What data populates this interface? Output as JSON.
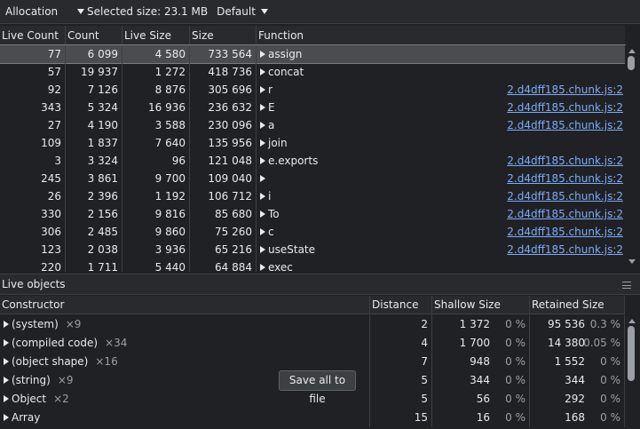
{
  "toolbar": {
    "mode_select": "Allocation",
    "selected_size": "Selected size: 23.1 MB",
    "view_select": "Default"
  },
  "allocation_table": {
    "columns": [
      "Live Count",
      "Count",
      "Live Size",
      "Size",
      "Function"
    ],
    "rows": [
      {
        "live_count": "77",
        "count": "6 099",
        "live_size": "4 580",
        "size": "733 564",
        "function": "assign",
        "source": ""
      },
      {
        "live_count": "57",
        "count": "19 937",
        "live_size": "1 272",
        "size": "418 736",
        "function": "concat",
        "source": ""
      },
      {
        "live_count": "92",
        "count": "7 126",
        "live_size": "8 876",
        "size": "305 696",
        "function": "r",
        "source": "2.d4dff185.chunk.js:2"
      },
      {
        "live_count": "343",
        "count": "5 324",
        "live_size": "16 936",
        "size": "236 632",
        "function": "E",
        "source": "2.d4dff185.chunk.js:2"
      },
      {
        "live_count": "27",
        "count": "4 190",
        "live_size": "3 588",
        "size": "230 096",
        "function": "a",
        "source": "2.d4dff185.chunk.js:2"
      },
      {
        "live_count": "109",
        "count": "1 837",
        "live_size": "7 640",
        "size": "135 956",
        "function": "join",
        "source": ""
      },
      {
        "live_count": "3",
        "count": "3 324",
        "live_size": "96",
        "size": "121 048",
        "function": "e.exports",
        "source": "2.d4dff185.chunk.js:2"
      },
      {
        "live_count": "245",
        "count": "3 861",
        "live_size": "9 700",
        "size": "109 040",
        "function": "",
        "source": "2.d4dff185.chunk.js:2"
      },
      {
        "live_count": "26",
        "count": "2 396",
        "live_size": "1 192",
        "size": "106 712",
        "function": "i",
        "source": "2.d4dff185.chunk.js:2"
      },
      {
        "live_count": "330",
        "count": "2 156",
        "live_size": "9 816",
        "size": "85 680",
        "function": "To",
        "source": "2.d4dff185.chunk.js:2"
      },
      {
        "live_count": "306",
        "count": "2 485",
        "live_size": "9 860",
        "size": "75 260",
        "function": "c",
        "source": "2.d4dff185.chunk.js:2"
      },
      {
        "live_count": "123",
        "count": "2 038",
        "live_size": "3 936",
        "size": "65 216",
        "function": "useState",
        "source": "2.d4dff185.chunk.js:2"
      },
      {
        "live_count": "220",
        "count": "1 711",
        "live_size": "5 440",
        "size": "64 884",
        "function": "exec",
        "source": ""
      }
    ]
  },
  "live_objects": {
    "title": "Live objects",
    "columns": [
      "Constructor",
      "Distance",
      "Shallow Size",
      "Retained Size"
    ],
    "rows": [
      {
        "name": "(system)",
        "mult": "×9",
        "distance": "2",
        "shallow": "1 372",
        "shallow_pct": "0 %",
        "retained": "95 536",
        "retained_pct": "0.3 %"
      },
      {
        "name": "(compiled code)",
        "mult": "×34",
        "distance": "4",
        "shallow": "1 700",
        "shallow_pct": "0 %",
        "retained": "14 380",
        "retained_pct": "0.05 %"
      },
      {
        "name": "(object shape)",
        "mult": "×16",
        "distance": "7",
        "shallow": "948",
        "shallow_pct": "0 %",
        "retained": "1 552",
        "retained_pct": "0 %"
      },
      {
        "name": "(string)",
        "mult": "×9",
        "distance": "5",
        "shallow": "344",
        "shallow_pct": "0 %",
        "retained": "344",
        "retained_pct": "0 %"
      },
      {
        "name": "Object",
        "mult": "×2",
        "distance": "5",
        "shallow": "56",
        "shallow_pct": "0 %",
        "retained": "292",
        "retained_pct": "0 %"
      },
      {
        "name": "Array",
        "mult": "",
        "distance": "15",
        "shallow": "16",
        "shallow_pct": "0 %",
        "retained": "168",
        "retained_pct": "0 %"
      }
    ],
    "save_button": "Save all to file"
  },
  "icons": {
    "dropdown": "caret-down-icon",
    "expand": "expand-triangle-icon",
    "menu": "menu-icon"
  },
  "colors": {
    "background": "#202124",
    "selected_row": "#4b4c4f",
    "link": "#7cacf8"
  }
}
